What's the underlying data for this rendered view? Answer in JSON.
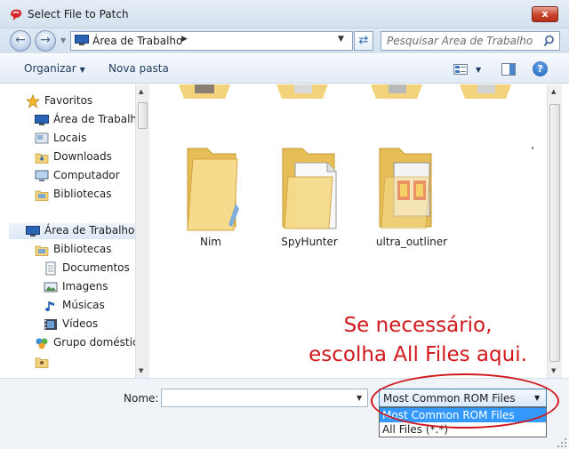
{
  "window": {
    "title": "Select File to Patch",
    "close_label": "x"
  },
  "address_bar": {
    "location": "Área de Trabalho",
    "search_placeholder": "Pesquisar Área de Trabalho"
  },
  "toolbar": {
    "organize_label": "Organizar",
    "new_folder_label": "Nova pasta"
  },
  "nav": {
    "favorites_label": "Favoritos",
    "favorites": [
      "Área de Trabalho",
      "Locais",
      "Downloads",
      "Computador",
      "Bibliotecas"
    ],
    "desktop_label": "Área de Trabalho",
    "tree": [
      {
        "label": "Bibliotecas",
        "icon": "libraries-icon",
        "indent": 1
      },
      {
        "label": "Documentos",
        "icon": "documents-icon",
        "indent": 2
      },
      {
        "label": "Imagens",
        "icon": "pictures-icon",
        "indent": 2
      },
      {
        "label": "Músicas",
        "icon": "music-icon",
        "indent": 2
      },
      {
        "label": "Vídeos",
        "icon": "videos-icon",
        "indent": 2
      },
      {
        "label": "Grupo doméstico",
        "icon": "homegroup-icon",
        "indent": 1
      }
    ]
  },
  "files": [
    {
      "name": "Nim"
    },
    {
      "name": "SpyHunter"
    },
    {
      "name": "ultra_outliner"
    }
  ],
  "annotation": {
    "line1": "Se necessário,",
    "line2": "escolha All Files aqui."
  },
  "bottom": {
    "name_label": "Nome:",
    "name_value": "",
    "file_type_selected": "Most Common ROM Files",
    "file_type_options": [
      "Most Common ROM Files",
      "All Files (*.*)"
    ]
  },
  "colors": {
    "annotation": "#d0181c",
    "highlight": "#3399ff",
    "folder": "#f2d27a"
  }
}
